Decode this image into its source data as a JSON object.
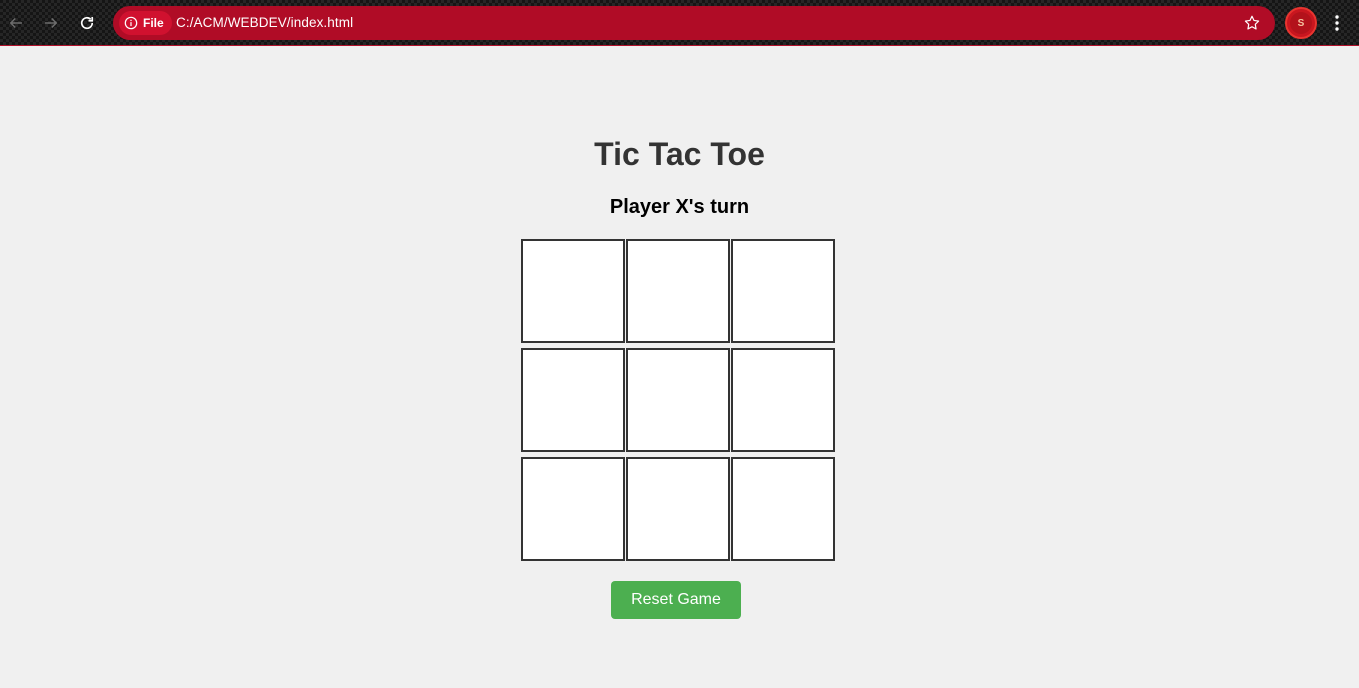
{
  "browser": {
    "chip_label": "File",
    "url": "C:/ACM/WEBDEV/index.html",
    "profile_initial": "S"
  },
  "game": {
    "title": "Tic Tac Toe",
    "status": "Player X's turn",
    "board": [
      "",
      "",
      "",
      "",
      "",
      "",
      "",
      "",
      ""
    ],
    "reset_label": "Reset Game"
  },
  "colors": {
    "omnibox": "#b00c26",
    "reset_button": "#4caf50",
    "cell_border": "#333333",
    "page_background": "#f0f0f0"
  }
}
